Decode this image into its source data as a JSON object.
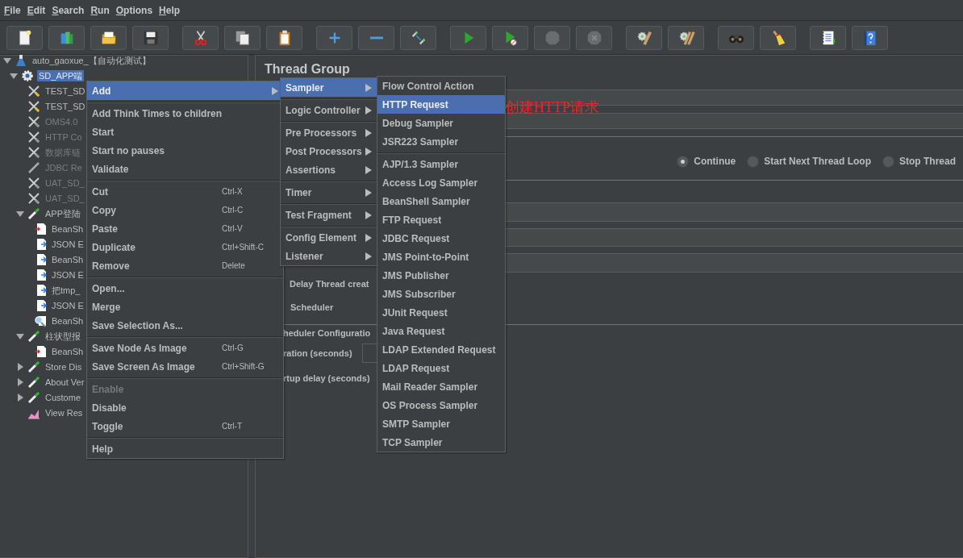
{
  "menubar": [
    "File",
    "Edit",
    "Search",
    "Run",
    "Options",
    "Help"
  ],
  "toolbar": [
    [
      {
        "kind": "new",
        "disabled": false
      },
      {
        "kind": "templates",
        "disabled": false
      },
      {
        "kind": "open",
        "disabled": false
      },
      {
        "kind": "save",
        "disabled": false
      }
    ],
    [
      {
        "kind": "cut",
        "disabled": false
      },
      {
        "kind": "copy",
        "disabled": false
      },
      {
        "kind": "paste",
        "disabled": false
      }
    ],
    [
      {
        "kind": "expand",
        "disabled": false
      },
      {
        "kind": "collapse",
        "disabled": false
      },
      {
        "kind": "toggle",
        "disabled": false
      }
    ],
    [
      {
        "kind": "start",
        "disabled": false
      },
      {
        "kind": "start-no-pauses",
        "disabled": false
      },
      {
        "kind": "stop",
        "disabled": true
      },
      {
        "kind": "shutdown",
        "disabled": true
      }
    ],
    [
      {
        "kind": "clear",
        "disabled": false
      },
      {
        "kind": "clear-all",
        "disabled": false
      }
    ],
    [
      {
        "kind": "search",
        "disabled": false
      },
      {
        "kind": "reset-search",
        "disabled": false
      }
    ],
    [
      {
        "kind": "log",
        "disabled": false
      },
      {
        "kind": "help",
        "disabled": false
      }
    ]
  ],
  "tree": {
    "items": [
      {
        "label": "auto_gaoxue_【自动化测试】",
        "kind": "test-plan",
        "expanded": true,
        "selected": false,
        "disabled": false,
        "children": [
          {
            "label": "SD_APP端",
            "kind": "thread-group",
            "expanded": true,
            "selected": true,
            "children": [
              {
                "label": "TEST_SD",
                "kind": "config",
                "selected": false,
                "disabled": false
              },
              {
                "label": "TEST_SD",
                "kind": "config",
                "selected": false,
                "disabled": false
              },
              {
                "label": "OMS4.0",
                "kind": "config",
                "selected": false,
                "disabled": true
              },
              {
                "label": "HTTP Co",
                "kind": "config",
                "selected": false,
                "disabled": true
              },
              {
                "label": "数据库链",
                "kind": "config",
                "selected": false,
                "disabled": true
              },
              {
                "label": "JDBC Re",
                "kind": "pen",
                "selected": false,
                "disabled": true
              },
              {
                "label": "UAT_SD_",
                "kind": "config",
                "selected": false,
                "disabled": true
              },
              {
                "label": "UAT_SD_",
                "kind": "config",
                "selected": false,
                "disabled": true
              },
              {
                "label": "APP登陆",
                "kind": "controller",
                "expanded": true,
                "selected": false,
                "disabled": false,
                "children": [
                  {
                    "label": "BeanSh",
                    "kind": "pre",
                    "selected": false,
                    "disabled": false
                  },
                  {
                    "label": "JSON E",
                    "kind": "post",
                    "selected": false,
                    "disabled": false
                  },
                  {
                    "label": "BeanSh",
                    "kind": "post",
                    "selected": false,
                    "disabled": false
                  },
                  {
                    "label": "JSON E",
                    "kind": "post",
                    "selected": false,
                    "disabled": false
                  },
                  {
                    "label": "把tmp_",
                    "kind": "post",
                    "selected": false,
                    "disabled": false
                  },
                  {
                    "label": "JSON E",
                    "kind": "post",
                    "selected": false,
                    "disabled": false
                  },
                  {
                    "label": "BeanSh",
                    "kind": "assertion",
                    "selected": false,
                    "disabled": false
                  }
                ]
              },
              {
                "label": "柱状型报",
                "kind": "controller",
                "expanded": true,
                "selected": false,
                "disabled": false,
                "children": [
                  {
                    "label": "BeanSh",
                    "kind": "pre",
                    "selected": false,
                    "disabled": false
                  }
                ]
              },
              {
                "label": "Store Dis",
                "kind": "controller",
                "expanded": false,
                "selected": false,
                "disabled": false
              },
              {
                "label": "About Ver",
                "kind": "controller",
                "expanded": false,
                "selected": false,
                "disabled": false
              },
              {
                "label": "Custome",
                "kind": "controller",
                "expanded": false,
                "selected": false,
                "disabled": false
              },
              {
                "label": "View Res",
                "kind": "listener",
                "selected": false,
                "disabled": false
              }
            ]
          }
        ]
      }
    ]
  },
  "thread_group": {
    "title": "Thread Group",
    "on_error": [
      {
        "label": "Continue",
        "selected": true
      },
      {
        "label": "Start Next Thread Loop",
        "selected": false
      },
      {
        "label": "Stop Thread",
        "selected": false
      }
    ],
    "delay_thread_creation": "Delay Thread creat",
    "scheduler": "Scheduler",
    "scheduler_configuration": "heduler Configuratio",
    "duration": "ration (seconds)",
    "startup_delay": "rtup delay (seconds)"
  },
  "context_menu": {
    "items": [
      {
        "kind": "item",
        "label": "Add",
        "selected": true,
        "disabled": false,
        "submenu": true
      },
      {
        "kind": "separator"
      },
      {
        "kind": "item",
        "label": "Add Think Times to children",
        "selected": false,
        "disabled": false
      },
      {
        "kind": "item",
        "label": "Start",
        "selected": false,
        "disabled": false
      },
      {
        "kind": "item",
        "label": "Start no pauses",
        "selected": false,
        "disabled": false
      },
      {
        "kind": "item",
        "label": "Validate",
        "selected": false,
        "disabled": false
      },
      {
        "kind": "separator"
      },
      {
        "kind": "item",
        "label": "Cut",
        "shortcut": "Ctrl-X",
        "selected": false,
        "disabled": false
      },
      {
        "kind": "item",
        "label": "Copy",
        "shortcut": "Ctrl-C",
        "selected": false,
        "disabled": false
      },
      {
        "kind": "item",
        "label": "Paste",
        "shortcut": "Ctrl-V",
        "selected": false,
        "disabled": false
      },
      {
        "kind": "item",
        "label": "Duplicate",
        "shortcut": "Ctrl+Shift-C",
        "selected": false,
        "disabled": false
      },
      {
        "kind": "item",
        "label": "Remove",
        "shortcut": "Delete",
        "selected": false,
        "disabled": false
      },
      {
        "kind": "separator"
      },
      {
        "kind": "item",
        "label": "Open...",
        "selected": false,
        "disabled": false
      },
      {
        "kind": "item",
        "label": "Merge",
        "selected": false,
        "disabled": false
      },
      {
        "kind": "item",
        "label": "Save Selection As...",
        "selected": false,
        "disabled": false
      },
      {
        "kind": "separator"
      },
      {
        "kind": "item",
        "label": "Save Node As Image",
        "shortcut": "Ctrl-G",
        "selected": false,
        "disabled": false
      },
      {
        "kind": "item",
        "label": "Save Screen As Image",
        "shortcut": "Ctrl+Shift-G",
        "selected": false,
        "disabled": false
      },
      {
        "kind": "separator"
      },
      {
        "kind": "item",
        "label": "Enable",
        "selected": false,
        "disabled": true
      },
      {
        "kind": "item",
        "label": "Disable",
        "selected": false,
        "disabled": false
      },
      {
        "kind": "item",
        "label": "Toggle",
        "shortcut": "Ctrl-T",
        "selected": false,
        "disabled": false
      },
      {
        "kind": "separator"
      },
      {
        "kind": "item",
        "label": "Help",
        "selected": false,
        "disabled": false
      }
    ]
  },
  "add_menu": {
    "items": [
      {
        "kind": "item",
        "label": "Sampler",
        "selected": true,
        "disabled": false,
        "submenu": true
      },
      {
        "kind": "separator"
      },
      {
        "kind": "item",
        "label": "Logic Controller",
        "selected": false,
        "disabled": false,
        "submenu": true
      },
      {
        "kind": "separator"
      },
      {
        "kind": "item",
        "label": "Pre Processors",
        "selected": false,
        "disabled": false,
        "submenu": true
      },
      {
        "kind": "item",
        "label": "Post Processors",
        "selected": false,
        "disabled": false,
        "submenu": true
      },
      {
        "kind": "item",
        "label": "Assertions",
        "selected": false,
        "disabled": false,
        "submenu": true
      },
      {
        "kind": "separator"
      },
      {
        "kind": "item",
        "label": "Timer",
        "selected": false,
        "disabled": false,
        "submenu": true
      },
      {
        "kind": "separator"
      },
      {
        "kind": "item",
        "label": "Test Fragment",
        "selected": false,
        "disabled": false,
        "submenu": true
      },
      {
        "kind": "separator"
      },
      {
        "kind": "item",
        "label": "Config Element",
        "selected": false,
        "disabled": false,
        "submenu": true
      },
      {
        "kind": "item",
        "label": "Listener",
        "selected": false,
        "disabled": false,
        "submenu": true
      }
    ]
  },
  "sampler_menu": {
    "items": [
      {
        "kind": "item",
        "label": "Flow Control Action",
        "selected": false,
        "disabled": false
      },
      {
        "kind": "item",
        "label": "HTTP Request",
        "selected": true,
        "disabled": false
      },
      {
        "kind": "item",
        "label": "Debug Sampler",
        "selected": false,
        "disabled": false
      },
      {
        "kind": "item",
        "label": "JSR223 Sampler",
        "selected": false,
        "disabled": false
      },
      {
        "kind": "separator"
      },
      {
        "kind": "item",
        "label": "AJP/1.3 Sampler",
        "selected": false,
        "disabled": false
      },
      {
        "kind": "item",
        "label": "Access Log Sampler",
        "selected": false,
        "disabled": false
      },
      {
        "kind": "item",
        "label": "BeanShell Sampler",
        "selected": false,
        "disabled": false
      },
      {
        "kind": "item",
        "label": "FTP Request",
        "selected": false,
        "disabled": false
      },
      {
        "kind": "item",
        "label": "JDBC Request",
        "selected": false,
        "disabled": false
      },
      {
        "kind": "item",
        "label": "JMS Point-to-Point",
        "selected": false,
        "disabled": false
      },
      {
        "kind": "item",
        "label": "JMS Publisher",
        "selected": false,
        "disabled": false
      },
      {
        "kind": "item",
        "label": "JMS Subscriber",
        "selected": false,
        "disabled": false
      },
      {
        "kind": "item",
        "label": "JUnit Request",
        "selected": false,
        "disabled": false
      },
      {
        "kind": "item",
        "label": "Java Request",
        "selected": false,
        "disabled": false
      },
      {
        "kind": "item",
        "label": "LDAP Extended Request",
        "selected": false,
        "disabled": false
      },
      {
        "kind": "item",
        "label": "LDAP Request",
        "selected": false,
        "disabled": false
      },
      {
        "kind": "item",
        "label": "Mail Reader Sampler",
        "selected": false,
        "disabled": false
      },
      {
        "kind": "item",
        "label": "OS Process Sampler",
        "selected": false,
        "disabled": false
      },
      {
        "kind": "item",
        "label": "SMTP Sampler",
        "selected": false,
        "disabled": false
      },
      {
        "kind": "item",
        "label": "TCP Sampler",
        "selected": false,
        "disabled": false
      }
    ]
  },
  "annotation": {
    "text": "创建HTTP请求"
  }
}
